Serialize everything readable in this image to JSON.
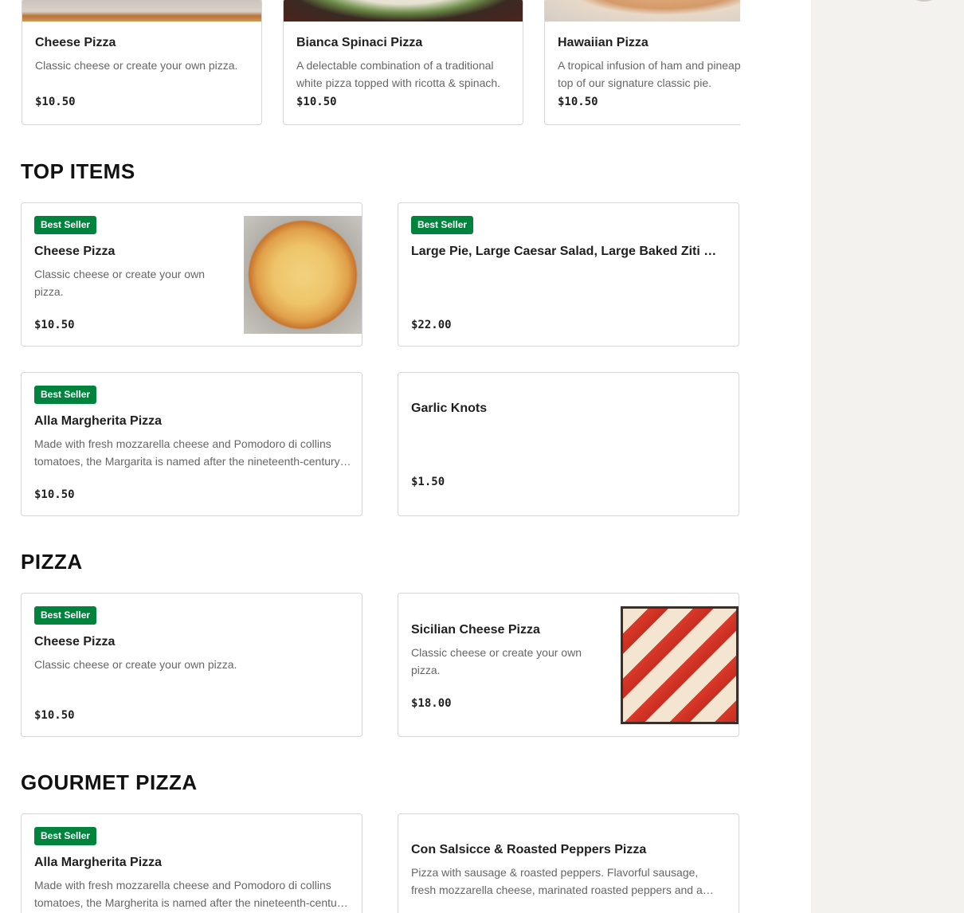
{
  "featured": [
    {
      "name": "Cheese Pizza",
      "description": "Classic cheese or create your own pizza.",
      "price": "$10.50",
      "image": "cheese-pizza-photo"
    },
    {
      "name": "Bianca Spinaci Pizza",
      "description": "A delectable combination of a traditional white pizza topped with ricotta & spinach.",
      "price": "$10.50",
      "image": "bianca-spinaci-photo"
    },
    {
      "name": "Hawaiian Pizza",
      "description": "A tropical infusion of ham and pineapple on top of our signature classic pie.",
      "price": "$10.50",
      "image": "hawaiian-pizza-photo"
    }
  ],
  "sections": {
    "top_items": {
      "title": "TOP ITEMS",
      "items": [
        {
          "badge": "Best Seller",
          "name": "Cheese Pizza",
          "description": "Classic cheese or create your own pizza.",
          "price": "$10.50",
          "image": "cheese-pizza-photo"
        },
        {
          "badge": "Best Seller",
          "name": "Large Pie, Large Caesar Salad, Large Baked Ziti & Garlic Knots",
          "description": "",
          "price": "$22.00"
        },
        {
          "badge": "Best Seller",
          "name": "Alla Margherita Pizza",
          "description": "Made with fresh mozzarella cheese and Pomodoro di collins tomatoes, the Margarita is named after the nineteenth-century Queen of Italy.",
          "price": "$10.50"
        },
        {
          "badge": "",
          "name": "Garlic Knots",
          "description": "",
          "price": "$1.50"
        }
      ]
    },
    "pizza": {
      "title": "PIZZA",
      "items": [
        {
          "badge": "Best Seller",
          "name": "Cheese Pizza",
          "description": "Classic cheese or create your own pizza.",
          "price": "$10.50"
        },
        {
          "badge": "",
          "name": "Sicilian Cheese Pizza",
          "description": "Classic cheese or create your own pizza.",
          "price": "$18.00",
          "image": "sicilian-pizza-photo"
        }
      ]
    },
    "gourmet_pizza": {
      "title": "GOURMET PIZZA",
      "items": [
        {
          "badge": "Best Seller",
          "name": "Alla Margherita Pizza",
          "description": "Made with fresh mozzarella cheese and Pomodoro di collins tomatoes, the Margherita is named after the nineteenth-century Queen of Italy.",
          "price": ""
        },
        {
          "badge": "",
          "name": "Con Salsicce & Roasted Peppers Pizza",
          "description": "Pizza with sausage & roasted peppers. Flavorful sausage, fresh mozzarella cheese, marinated roasted peppers and a touch of basil.",
          "price": ""
        }
      ]
    }
  },
  "colors": {
    "badge": "#00833d",
    "panel": "#f3f2ef",
    "border": "#d6d6d6"
  }
}
